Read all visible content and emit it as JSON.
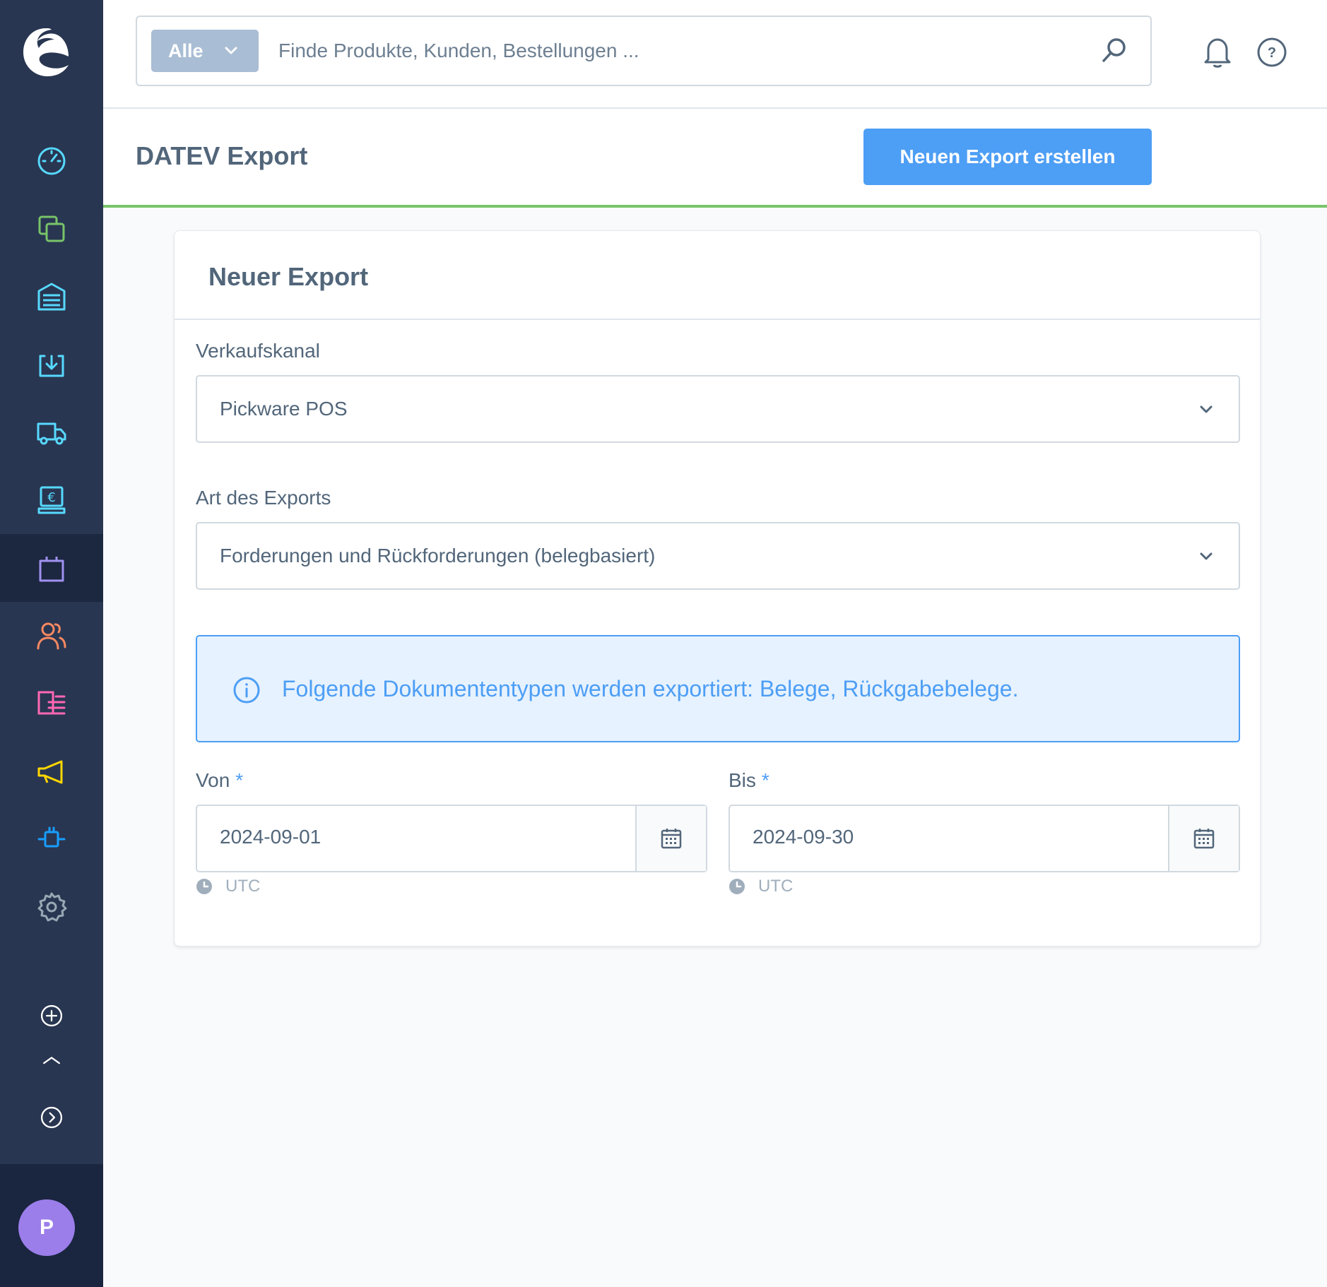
{
  "sidebar": {
    "items": [
      {
        "name": "dashboard",
        "icon": "gauge-icon",
        "color": "#57d9ff"
      },
      {
        "name": "catalogues",
        "icon": "copy-icon",
        "color": "#78c469"
      },
      {
        "name": "warehouse",
        "icon": "warehouse-icon",
        "color": "#57d9ff"
      },
      {
        "name": "receiving",
        "icon": "stock-in-icon",
        "color": "#57d9ff"
      },
      {
        "name": "shipping",
        "icon": "truck-icon",
        "color": "#57d9ff"
      },
      {
        "name": "pos",
        "icon": "cash-register-icon",
        "color": "#57d9ff"
      },
      {
        "name": "orders",
        "icon": "shopping-bag-icon",
        "color": "#a092f0",
        "active": true
      },
      {
        "name": "customers",
        "icon": "users-icon",
        "color": "#f88962"
      },
      {
        "name": "content",
        "icon": "content-list-icon",
        "color": "#ff68b4"
      },
      {
        "name": "marketing",
        "icon": "megaphone-icon",
        "color": "#ffd700"
      },
      {
        "name": "extensions",
        "icon": "plug-icon",
        "color": "#189eff"
      },
      {
        "name": "settings",
        "icon": "gear-icon",
        "color": "#9aa8b5"
      }
    ],
    "avatar_initial": "P",
    "avatar_color": "#9b7eea"
  },
  "search": {
    "type_label": "Alle",
    "placeholder": "Finde Produkte, Kunden, Bestellungen ..."
  },
  "header": {
    "title": "DATEV Export",
    "create_button": "Neuen Export erstellen"
  },
  "card": {
    "title": "Neuer Export",
    "sales_channel": {
      "label": "Verkaufskanal",
      "value": "Pickware POS"
    },
    "export_type": {
      "label": "Art des Exports",
      "value": "Forderungen und Rückforderungen (belegbasiert)"
    },
    "info": "Folgende Dokumententypen werden exportiert: Belege, Rückgabebelege.",
    "from": {
      "label": "Von",
      "required": "*",
      "value": "2024-09-01",
      "timezone": "UTC"
    },
    "to": {
      "label": "Bis",
      "required": "*",
      "value": "2024-09-30",
      "timezone": "UTC"
    }
  },
  "colors": {
    "accent": "#4d9ef5",
    "sidebar": "#293651",
    "header_border": "#78c469"
  }
}
